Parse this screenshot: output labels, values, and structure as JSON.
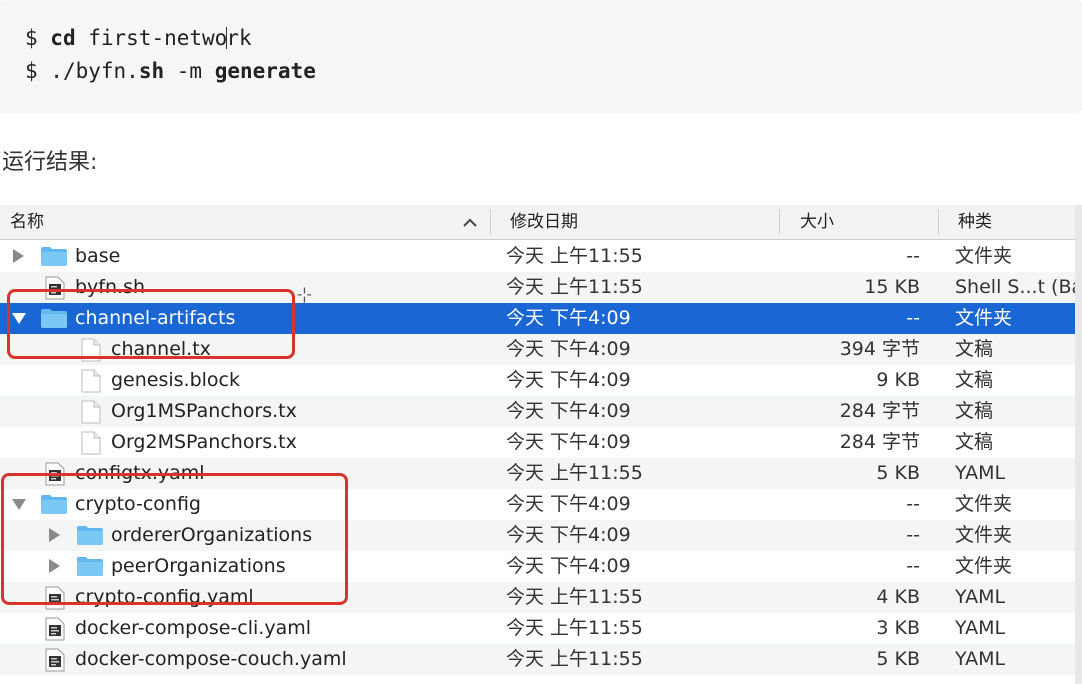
{
  "code": {
    "line1_prompt": "$ ",
    "line1_cmd": "cd",
    "line1_arg_a": " first-netwo",
    "line1_arg_b": "rk",
    "line2_prompt": "$ ",
    "line2_script_a": "./byfn.",
    "line2_script_b": "sh",
    "line2_flag": " -m ",
    "line2_arg": "generate"
  },
  "result_label": "运行结果:",
  "finder": {
    "columns": {
      "name": "名称",
      "date": "修改日期",
      "size": "大小",
      "kind": "种类"
    },
    "rows": [
      {
        "name": "base",
        "date": "今天 上午11:55",
        "size": "--",
        "kind": "文件夹",
        "icon": "folder-icon",
        "indent": 0,
        "disclosure": "collapsed"
      },
      {
        "name": "byfn.sh",
        "date": "今天 上午11:55",
        "size": "15 KB",
        "kind": "Shell S...t (Ba",
        "icon": "script-file-icon",
        "indent": 0,
        "disclosure": "none"
      },
      {
        "name": "channel-artifacts",
        "date": "今天 下午4:09",
        "size": "--",
        "kind": "文件夹",
        "icon": "folder-icon",
        "indent": 0,
        "disclosure": "expanded",
        "selected": true
      },
      {
        "name": "channel.tx",
        "date": "今天 下午4:09",
        "size": "394 字节",
        "kind": "文稿",
        "icon": "document-icon",
        "indent": 1,
        "disclosure": "none"
      },
      {
        "name": "genesis.block",
        "date": "今天 下午4:09",
        "size": "9 KB",
        "kind": "文稿",
        "icon": "document-icon",
        "indent": 1,
        "disclosure": "none"
      },
      {
        "name": "Org1MSPanchors.tx",
        "date": "今天 下午4:09",
        "size": "284 字节",
        "kind": "文稿",
        "icon": "document-icon",
        "indent": 1,
        "disclosure": "none"
      },
      {
        "name": "Org2MSPanchors.tx",
        "date": "今天 下午4:09",
        "size": "284 字节",
        "kind": "文稿",
        "icon": "document-icon",
        "indent": 1,
        "disclosure": "none"
      },
      {
        "name": "configtx.yaml",
        "date": "今天 上午11:55",
        "size": "5 KB",
        "kind": "YAML",
        "icon": "script-file-icon",
        "indent": 0,
        "disclosure": "none"
      },
      {
        "name": "crypto-config",
        "date": "今天 下午4:09",
        "size": "--",
        "kind": "文件夹",
        "icon": "folder-icon",
        "indent": 0,
        "disclosure": "expanded"
      },
      {
        "name": "ordererOrganizations",
        "date": "今天 下午4:09",
        "size": "--",
        "kind": "文件夹",
        "icon": "folder-icon",
        "indent": 1,
        "disclosure": "collapsed"
      },
      {
        "name": "peerOrganizations",
        "date": "今天 下午4:09",
        "size": "--",
        "kind": "文件夹",
        "icon": "folder-icon",
        "indent": 1,
        "disclosure": "collapsed"
      },
      {
        "name": "crypto-config.yaml",
        "date": "今天 上午11:55",
        "size": "4 KB",
        "kind": "YAML",
        "icon": "script-file-icon",
        "indent": 0,
        "disclosure": "none"
      },
      {
        "name": "docker-compose-cli.yaml",
        "date": "今天 上午11:55",
        "size": "3 KB",
        "kind": "YAML",
        "icon": "script-file-icon",
        "indent": 0,
        "disclosure": "none"
      },
      {
        "name": "docker-compose-couch.yaml",
        "date": "今天 上午11:55",
        "size": "5 KB",
        "kind": "YAML",
        "icon": "script-file-icon",
        "indent": 0,
        "disclosure": "none"
      }
    ]
  },
  "colors": {
    "selection": "#1a66d4",
    "annotation": "#d9342b",
    "folder": "#5fb8ef"
  }
}
